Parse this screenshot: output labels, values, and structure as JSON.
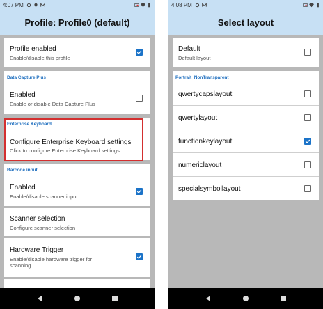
{
  "left": {
    "status": {
      "time": "4:07 PM"
    },
    "title": "Profile: Profile0 (default)",
    "profile_enabled": {
      "title": "Profile enabled",
      "sub": "Enable/disable this profile",
      "checked": true
    },
    "dcp_category": "Data Capture Plus",
    "dcp_enabled": {
      "title": "Enabled",
      "sub": "Enable or disable Data Capture Plus",
      "checked": false
    },
    "ek_category": "Enterprise Keyboard",
    "ek_configure": {
      "title": "Configure Enterprise Keyboard settings",
      "sub": "Click to configure Enterprise Keyboard settings"
    },
    "barcode_category": "Barcode input",
    "barcode_enabled": {
      "title": "Enabled",
      "sub": "Enable/disable scanner input",
      "checked": true
    },
    "scanner_selection": {
      "title": "Scanner selection",
      "sub": "Configure scanner selection"
    },
    "hardware_trigger": {
      "title": "Hardware Trigger",
      "sub": "Enable/disable hardware trigger for scanning",
      "checked": true
    }
  },
  "right": {
    "status": {
      "time": "4:08 PM"
    },
    "title": "Select layout",
    "default_item": {
      "title": "Default",
      "sub": "Default layout",
      "checked": false
    },
    "category": "Portrait_NonTransparent",
    "layouts": [
      {
        "label": "qwertycapslayout",
        "checked": false
      },
      {
        "label": "qwertylayout",
        "checked": false
      },
      {
        "label": "functionkeylayout",
        "checked": true
      },
      {
        "label": "numericlayout",
        "checked": false
      },
      {
        "label": "specialsymbollayout",
        "checked": false
      }
    ]
  },
  "colors": {
    "accent": "#1b73c8",
    "appbar": "#c7e0f4",
    "highlight": "#d32f2f",
    "category_text": "#1f6fbf"
  },
  "icons": {
    "nav": [
      "back-icon",
      "home-icon",
      "recents-icon"
    ]
  }
}
